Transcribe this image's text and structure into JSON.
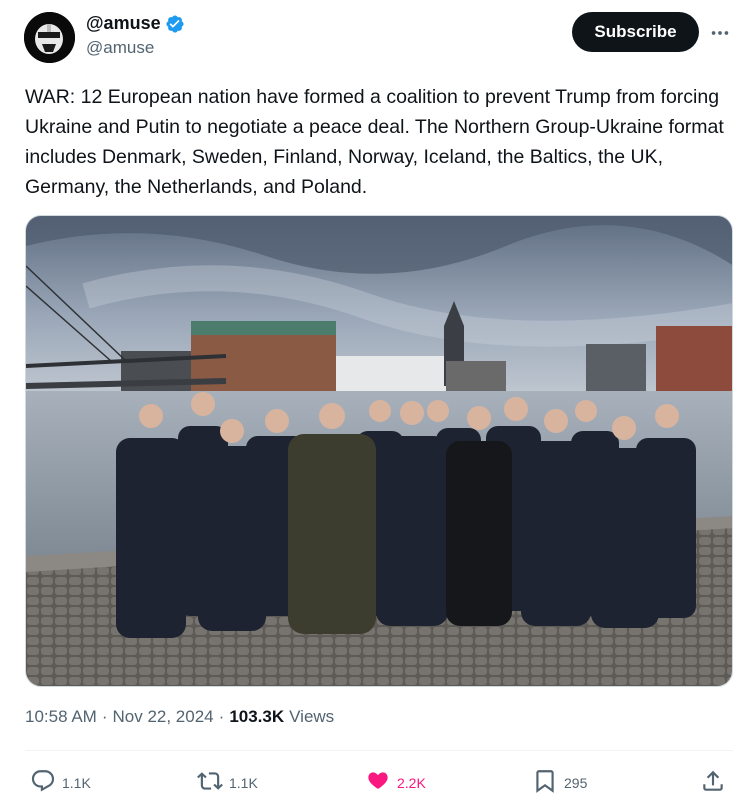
{
  "author": {
    "display_name": "@amuse",
    "handle": "@amuse",
    "verified": true
  },
  "header": {
    "subscribe_label": "Subscribe"
  },
  "tweet": {
    "text": "WAR: 12 European nation have formed a coalition to prevent Trump from forcing Ukraine and Putin to negotiate a peace deal. The Northern Group-Ukraine format includes Denmark, Sweden, Finland, Norway, Iceland, the Baltics, the UK, Germany, the Netherlands, and Poland."
  },
  "meta": {
    "time": "10:58 AM",
    "separator": "·",
    "date": "Nov 22, 2024",
    "views_count": "103.3K",
    "views_label": "Views"
  },
  "actions": {
    "replies": "1.1K",
    "reposts": "1.1K",
    "likes": "2.2K",
    "bookmarks": "295"
  },
  "colors": {
    "accent": "#1d9bf0",
    "like": "#f91880",
    "text": "#0f1419",
    "muted": "#536471"
  }
}
